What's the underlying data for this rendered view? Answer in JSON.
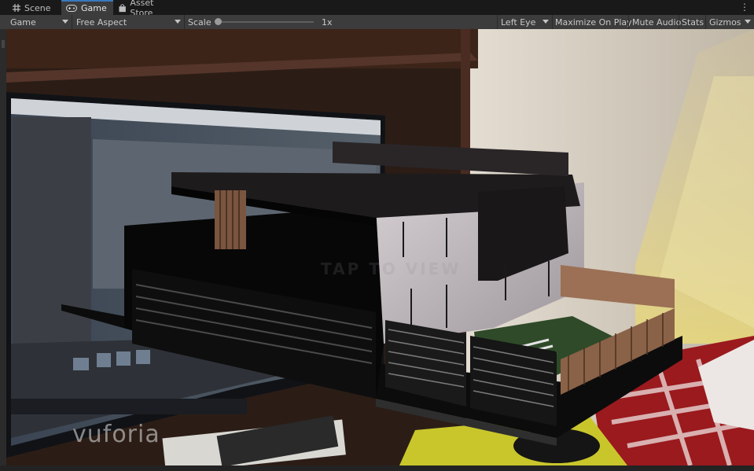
{
  "tabs": [
    {
      "label": "Scene",
      "icon": "hash-icon",
      "active": false
    },
    {
      "label": "Game",
      "icon": "gamepad-icon",
      "active": true
    },
    {
      "label": "Asset Store",
      "icon": "bag-icon",
      "active": false
    }
  ],
  "toolbar": {
    "display": "Game",
    "aspect": "Free Aspect",
    "scale_label": "Scale",
    "scale_value": "1x",
    "eye": "Left Eye",
    "maximize_on_play": "Maximize On Play",
    "mute_audio": "Mute Audio",
    "stats": "Stats",
    "gizmos": "Gizmos"
  },
  "viewport": {
    "brand_logo": "vuforia"
  },
  "colors": {
    "accent": "#3a79bb",
    "panel": "#3c3c3c",
    "background": "#191919"
  }
}
